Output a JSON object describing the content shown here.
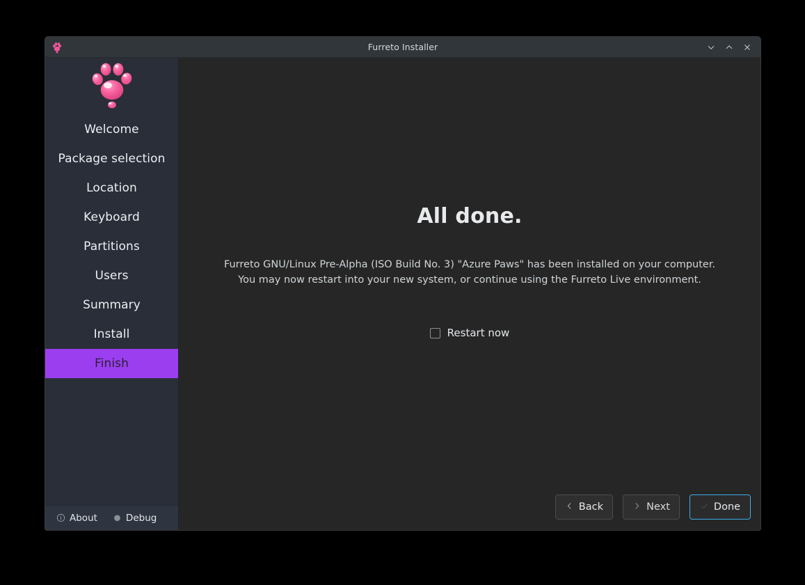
{
  "titlebar": {
    "title": "Furreto Installer",
    "app_icon": "paw-icon",
    "controls": [
      {
        "name": "minimize-button",
        "icon": "chevron-down-icon"
      },
      {
        "name": "maximize-button",
        "icon": "chevron-up-icon"
      },
      {
        "name": "close-button",
        "icon": "close-x-icon"
      }
    ]
  },
  "sidebar": {
    "logo": "paw-logo",
    "items": [
      {
        "label": "Welcome",
        "active": false
      },
      {
        "label": "Package selection",
        "active": false
      },
      {
        "label": "Location",
        "active": false
      },
      {
        "label": "Keyboard",
        "active": false
      },
      {
        "label": "Partitions",
        "active": false
      },
      {
        "label": "Users",
        "active": false
      },
      {
        "label": "Summary",
        "active": false
      },
      {
        "label": "Install",
        "active": false
      },
      {
        "label": "Finish",
        "active": true
      }
    ],
    "active_color": "#9b3ef0",
    "footer": {
      "about_label": "About",
      "about_icon": "info-icon",
      "debug_label": "Debug",
      "debug_icon": "bug-icon"
    }
  },
  "main": {
    "headline": "All done.",
    "paragraph_line1": "Furreto GNU/Linux Pre-Alpha (ISO Build No. 3) \"Azure Paws\" has been installed on your computer.",
    "paragraph_line2": "You may now restart into your new system, or continue using the Furreto Live environment.",
    "restart_checkbox": {
      "label": "Restart now",
      "checked": false
    }
  },
  "buttons": {
    "back": {
      "label": "Back",
      "icon": "chevron-left-icon"
    },
    "next": {
      "label": "Next",
      "icon": "chevron-right-icon"
    },
    "done": {
      "label": "Done",
      "icon": "check-icon",
      "focus_color": "#3daee9"
    }
  }
}
